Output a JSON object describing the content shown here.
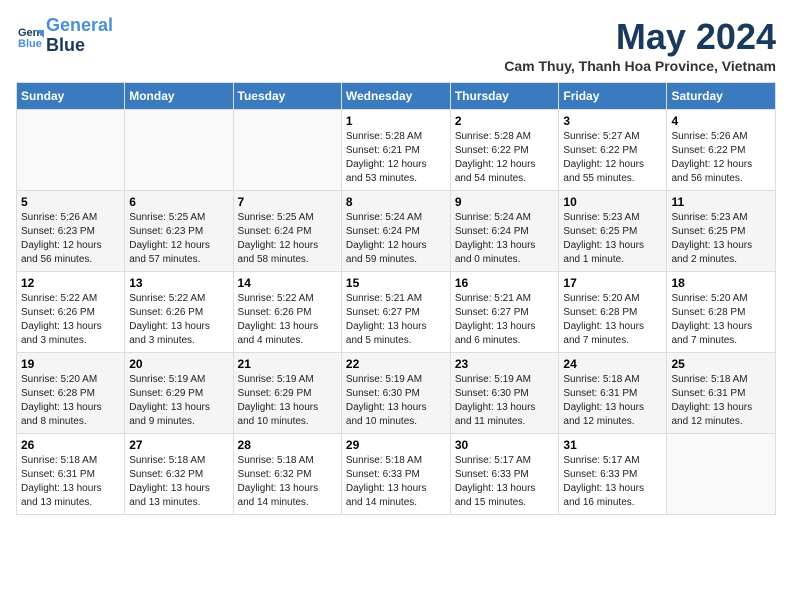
{
  "header": {
    "logo_line1": "General",
    "logo_line2": "Blue",
    "month": "May 2024",
    "location": "Cam Thuy, Thanh Hoa Province, Vietnam"
  },
  "weekdays": [
    "Sunday",
    "Monday",
    "Tuesday",
    "Wednesday",
    "Thursday",
    "Friday",
    "Saturday"
  ],
  "weeks": [
    [
      {
        "day": "",
        "info": ""
      },
      {
        "day": "",
        "info": ""
      },
      {
        "day": "",
        "info": ""
      },
      {
        "day": "1",
        "info": "Sunrise: 5:28 AM\nSunset: 6:21 PM\nDaylight: 12 hours\nand 53 minutes."
      },
      {
        "day": "2",
        "info": "Sunrise: 5:28 AM\nSunset: 6:22 PM\nDaylight: 12 hours\nand 54 minutes."
      },
      {
        "day": "3",
        "info": "Sunrise: 5:27 AM\nSunset: 6:22 PM\nDaylight: 12 hours\nand 55 minutes."
      },
      {
        "day": "4",
        "info": "Sunrise: 5:26 AM\nSunset: 6:22 PM\nDaylight: 12 hours\nand 56 minutes."
      }
    ],
    [
      {
        "day": "5",
        "info": "Sunrise: 5:26 AM\nSunset: 6:23 PM\nDaylight: 12 hours\nand 56 minutes."
      },
      {
        "day": "6",
        "info": "Sunrise: 5:25 AM\nSunset: 6:23 PM\nDaylight: 12 hours\nand 57 minutes."
      },
      {
        "day": "7",
        "info": "Sunrise: 5:25 AM\nSunset: 6:24 PM\nDaylight: 12 hours\nand 58 minutes."
      },
      {
        "day": "8",
        "info": "Sunrise: 5:24 AM\nSunset: 6:24 PM\nDaylight: 12 hours\nand 59 minutes."
      },
      {
        "day": "9",
        "info": "Sunrise: 5:24 AM\nSunset: 6:24 PM\nDaylight: 13 hours\nand 0 minutes."
      },
      {
        "day": "10",
        "info": "Sunrise: 5:23 AM\nSunset: 6:25 PM\nDaylight: 13 hours\nand 1 minute."
      },
      {
        "day": "11",
        "info": "Sunrise: 5:23 AM\nSunset: 6:25 PM\nDaylight: 13 hours\nand 2 minutes."
      }
    ],
    [
      {
        "day": "12",
        "info": "Sunrise: 5:22 AM\nSunset: 6:26 PM\nDaylight: 13 hours\nand 3 minutes."
      },
      {
        "day": "13",
        "info": "Sunrise: 5:22 AM\nSunset: 6:26 PM\nDaylight: 13 hours\nand 3 minutes."
      },
      {
        "day": "14",
        "info": "Sunrise: 5:22 AM\nSunset: 6:26 PM\nDaylight: 13 hours\nand 4 minutes."
      },
      {
        "day": "15",
        "info": "Sunrise: 5:21 AM\nSunset: 6:27 PM\nDaylight: 13 hours\nand 5 minutes."
      },
      {
        "day": "16",
        "info": "Sunrise: 5:21 AM\nSunset: 6:27 PM\nDaylight: 13 hours\nand 6 minutes."
      },
      {
        "day": "17",
        "info": "Sunrise: 5:20 AM\nSunset: 6:28 PM\nDaylight: 13 hours\nand 7 minutes."
      },
      {
        "day": "18",
        "info": "Sunrise: 5:20 AM\nSunset: 6:28 PM\nDaylight: 13 hours\nand 7 minutes."
      }
    ],
    [
      {
        "day": "19",
        "info": "Sunrise: 5:20 AM\nSunset: 6:28 PM\nDaylight: 13 hours\nand 8 minutes."
      },
      {
        "day": "20",
        "info": "Sunrise: 5:19 AM\nSunset: 6:29 PM\nDaylight: 13 hours\nand 9 minutes."
      },
      {
        "day": "21",
        "info": "Sunrise: 5:19 AM\nSunset: 6:29 PM\nDaylight: 13 hours\nand 10 minutes."
      },
      {
        "day": "22",
        "info": "Sunrise: 5:19 AM\nSunset: 6:30 PM\nDaylight: 13 hours\nand 10 minutes."
      },
      {
        "day": "23",
        "info": "Sunrise: 5:19 AM\nSunset: 6:30 PM\nDaylight: 13 hours\nand 11 minutes."
      },
      {
        "day": "24",
        "info": "Sunrise: 5:18 AM\nSunset: 6:31 PM\nDaylight: 13 hours\nand 12 minutes."
      },
      {
        "day": "25",
        "info": "Sunrise: 5:18 AM\nSunset: 6:31 PM\nDaylight: 13 hours\nand 12 minutes."
      }
    ],
    [
      {
        "day": "26",
        "info": "Sunrise: 5:18 AM\nSunset: 6:31 PM\nDaylight: 13 hours\nand 13 minutes."
      },
      {
        "day": "27",
        "info": "Sunrise: 5:18 AM\nSunset: 6:32 PM\nDaylight: 13 hours\nand 13 minutes."
      },
      {
        "day": "28",
        "info": "Sunrise: 5:18 AM\nSunset: 6:32 PM\nDaylight: 13 hours\nand 14 minutes."
      },
      {
        "day": "29",
        "info": "Sunrise: 5:18 AM\nSunset: 6:33 PM\nDaylight: 13 hours\nand 14 minutes."
      },
      {
        "day": "30",
        "info": "Sunrise: 5:17 AM\nSunset: 6:33 PM\nDaylight: 13 hours\nand 15 minutes."
      },
      {
        "day": "31",
        "info": "Sunrise: 5:17 AM\nSunset: 6:33 PM\nDaylight: 13 hours\nand 16 minutes."
      },
      {
        "day": "",
        "info": ""
      }
    ]
  ]
}
